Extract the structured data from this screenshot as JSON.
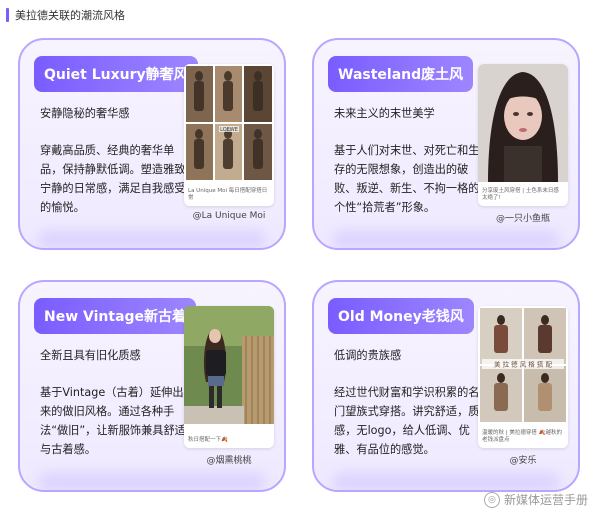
{
  "header": {
    "title": "美拉德关联的潮流风格"
  },
  "cards": [
    {
      "title": "Quiet Luxury静奢风",
      "tagline": "安静隐秘的奢华感",
      "body": "穿戴高品质、经典的奢华单品，保持静默低调。塑造雅致宁静的日常感，满足自我感受的愉悦。",
      "thumb_caption": "La Unique Moi 每日搭配穿搭日常",
      "thumb_caption_extra": "LOEWE",
      "credit": "@La Unique Moi"
    },
    {
      "title": "Wasteland废土风",
      "tagline": "未来主义的末世美学",
      "body": "基于人们对末世、对死亡和生存的无限想象，创造出的破败、叛逆、新生、不拘一格的个性“拾荒者”形象。",
      "thumb_caption": "分享废土风穿搭 | 土色系末日感太绝了!",
      "credit": "@一只小鱼瓶"
    },
    {
      "title": "New Vintage新古着",
      "tagline": "全新且具有旧化质感",
      "body": "基于Vintage（古着）延伸出来的做旧风格。通过各种手法“做旧”，让新服饰兼具舒适与古着感。",
      "thumb_caption": "秋日搭配一下🍂",
      "credit": "@烟熏桃桃"
    },
    {
      "title": "Old Money老钱风",
      "tagline": "低调的贵族感",
      "body": "经过世代财富和学识积累的名门望族式穿搭。讲究舒适，质感，无logo，给人低调、优雅、有品位的感觉。",
      "thumb_caption": "温暖的秋 | 美拉德穿搭 🍂越秋的老钱派盘点",
      "thumb_overlay": "美 拉 德 风 格 搭 配",
      "credit": "@安乐"
    }
  ],
  "watermark": {
    "text": "新媒体运营手册"
  }
}
